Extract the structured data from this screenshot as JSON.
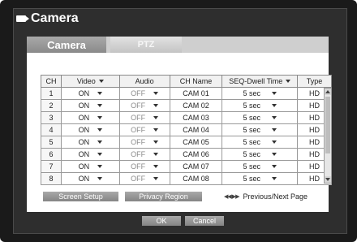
{
  "window": {
    "title": "Camera",
    "title_icon": "camera-icon"
  },
  "tabs": [
    {
      "label": "Camera",
      "active": true
    },
    {
      "label": "PTZ",
      "active": false
    }
  ],
  "table": {
    "headers": {
      "ch": "CH",
      "video": "Video",
      "audio": "Audio",
      "cam_name": "CH Name",
      "seq": "SEQ-Dwell Time",
      "type": "Type"
    },
    "rows": [
      {
        "ch": "1",
        "video": "ON",
        "audio": "OFF",
        "name": "CAM 01",
        "seq": "5 sec",
        "type": "HD"
      },
      {
        "ch": "2",
        "video": "ON",
        "audio": "OFF",
        "name": "CAM 02",
        "seq": "5 sec",
        "type": "HD"
      },
      {
        "ch": "3",
        "video": "ON",
        "audio": "OFF",
        "name": "CAM 03",
        "seq": "5 sec",
        "type": "HD"
      },
      {
        "ch": "4",
        "video": "ON",
        "audio": "OFF",
        "name": "CAM 04",
        "seq": "5 sec",
        "type": "HD"
      },
      {
        "ch": "5",
        "video": "ON",
        "audio": "OFF",
        "name": "CAM 05",
        "seq": "5 sec",
        "type": "HD"
      },
      {
        "ch": "6",
        "video": "ON",
        "audio": "OFF",
        "name": "CAM 06",
        "seq": "5 sec",
        "type": "HD"
      },
      {
        "ch": "7",
        "video": "ON",
        "audio": "OFF",
        "name": "CAM 07",
        "seq": "5 sec",
        "type": "HD"
      },
      {
        "ch": "8",
        "video": "ON",
        "audio": "OFF",
        "name": "CAM 08",
        "seq": "5 sec",
        "type": "HD"
      }
    ]
  },
  "buttons": {
    "screen_setup": "Screen Setup",
    "privacy_region": "Privacy Region",
    "ok": "OK",
    "cancel": "Cancel"
  },
  "pager": {
    "label": "Previous/Next Page",
    "icon": "rewind-fastforward-icon"
  }
}
